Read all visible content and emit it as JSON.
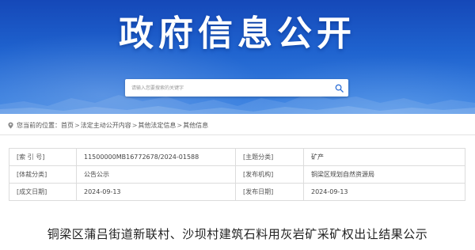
{
  "header": {
    "title": "政府信息公开",
    "colors": {
      "banner_top": "#1548b8",
      "banner_bottom": "#3f86e3"
    }
  },
  "search": {
    "placeholder": "请输入您要搜索的关键字",
    "button_icon": "search-icon"
  },
  "breadcrumb": {
    "icon": "location-pin-icon",
    "prefix": "您当前的位置：",
    "items": [
      "首页",
      "法定主动公开内容",
      "其他法定信息",
      "其他信息"
    ],
    "separator": ">"
  },
  "metadata": {
    "rows": [
      {
        "k1": "[索 引 号]",
        "v1": "11500000MB16772678/2024-01588",
        "k2": "[主题分类]",
        "v2": "矿产"
      },
      {
        "k1": "[体裁分类]",
        "v1": "公告公示",
        "k2": "[发布机构]",
        "v2": "铜梁区规划自然资源局"
      },
      {
        "k1": "[成文日期]",
        "v1": "2024-09-13",
        "k2": "[发布日期]",
        "v2": "2024-09-13"
      }
    ]
  },
  "document": {
    "title": "铜梁区蒲吕街道新联村、沙坝村建筑石料用灰岩矿采矿权出让结果公示"
  }
}
